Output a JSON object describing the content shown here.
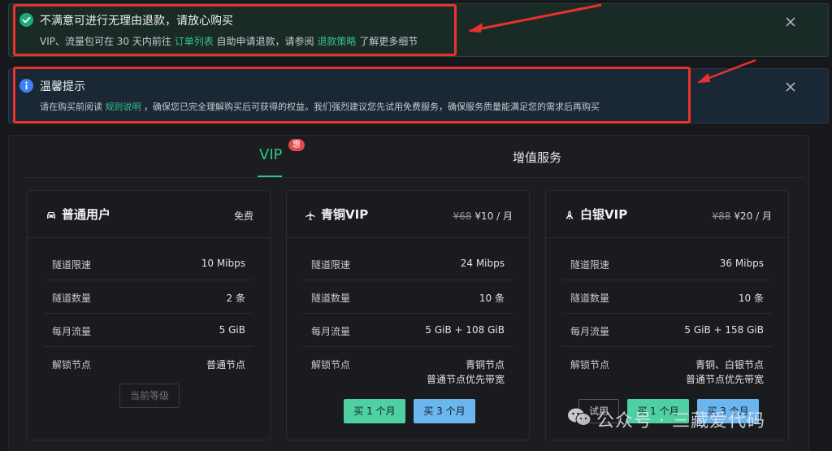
{
  "alerts": {
    "success": {
      "title": "不满意可进行无理由退款，请放心购买",
      "desc_1": "VIP、流量包可在 30 天内前往 ",
      "link_1": "订单列表",
      "desc_2": " 自助申请退款，请参阅 ",
      "link_2": "退款策略",
      "desc_3": " 了解更多细节"
    },
    "info": {
      "title": "温馨提示",
      "desc_1": "请在购买前阅读 ",
      "link_1": "规则说明",
      "desc_2": " ，确保您已完全理解购买后可获得的权益。我们强烈建议您先试用免费服务，确保服务质量能满足您的需求后再购买"
    }
  },
  "tabs": {
    "vip": "VIP",
    "vip_badge": "惠",
    "value_added": "增值服务"
  },
  "cards": [
    {
      "name": "普通用户",
      "icon": "car-icon",
      "price_old": "",
      "price": "免费",
      "rows": [
        {
          "k": "隧道限速",
          "v": "10 Mibps"
        },
        {
          "k": "隧道数量",
          "v": "2 条"
        },
        {
          "k": "每月流量",
          "v": "5 GiB"
        },
        {
          "k": "解锁节点",
          "v": "普通节点",
          "v2": ""
        }
      ],
      "buttons": [
        "当前等级"
      ]
    },
    {
      "name": "青铜VIP",
      "icon": "plane-icon",
      "price_old": "¥68",
      "price": "¥10 / 月",
      "rows": [
        {
          "k": "隧道限速",
          "v": "24 Mibps"
        },
        {
          "k": "隧道数量",
          "v": "10 条"
        },
        {
          "k": "每月流量",
          "v": "5 GiB + 108 GiB"
        },
        {
          "k": "解锁节点",
          "v": "青铜节点",
          "v2": "普通节点优先带宽"
        }
      ],
      "buttons": [
        "买 1 个月",
        "买 3 个月"
      ]
    },
    {
      "name": "白银VIP",
      "icon": "rocket-icon",
      "price_old": "¥88",
      "price": "¥20 / 月",
      "rows": [
        {
          "k": "隧道限速",
          "v": "36 Mibps"
        },
        {
          "k": "隧道数量",
          "v": "10 条"
        },
        {
          "k": "每月流量",
          "v": "5 GiB + 158 GiB"
        },
        {
          "k": "解锁节点",
          "v": "青铜、白银节点",
          "v2": "普通节点优先带宽"
        }
      ],
      "buttons": [
        "试用",
        "买 1 个月",
        "买 3 个月"
      ]
    }
  ],
  "watermark": "公众号 · 三藏爱代码",
  "colors": {
    "accent_green": "#2ec585",
    "highlight_red": "#e8322c",
    "button_green": "#4fd0a2",
    "button_blue": "#6cb6ef"
  }
}
